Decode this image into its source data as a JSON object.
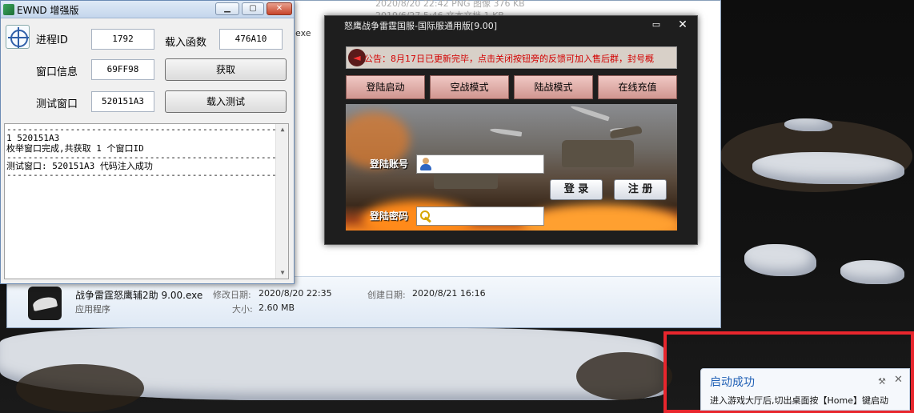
{
  "explorer": {
    "top_row_1": "2020/8/20 22:42     PNG 图像        376 KB",
    "top_row_2": "2019/6/27 5:46       文本文档          1 KB",
    "exe_label": "exe",
    "details": {
      "file_name": "战争雷霆怒鹰辅2助 9.00.exe",
      "file_type": "应用程序",
      "modified_label": "修改日期:",
      "modified_value": "2020/8/20 22:35",
      "created_label": "创建日期:",
      "created_value": "2020/8/21 16:16",
      "size_label": "大小:",
      "size_value": "2.60 MB"
    }
  },
  "ewnd": {
    "title": "EWND 增强版",
    "buttons": {
      "minimize": "▁",
      "maximize": "▢",
      "close": "✕"
    },
    "process_id_label": "进程ID",
    "process_id_value": "1792",
    "load_func_label": "载入函数",
    "load_func_value": "476A10",
    "window_info_label": "窗口信息",
    "window_info_value": "69FF98",
    "get_button": "获取",
    "test_window_label": "测试窗口",
    "test_window_value": "520151A3",
    "load_test_button": "载入测试",
    "log": {
      "separator": "------------------------------------------------------------",
      "line1": "1 520151A3",
      "line2": "枚举窗口完成,共获取 1 个窗口ID",
      "line3": "测试窗口: 520151A3 代码注入成功"
    }
  },
  "game": {
    "title": "怒鹰战争雷霆国服-国际服通用版[9.00]",
    "chat_icon": "💬",
    "close_icon": "✕",
    "notice": "公告：8月17日已更新完毕，点击关闭按钮旁的反馈可加入售后群，封号概",
    "modes": [
      "登陆启动",
      "空战模式",
      "陆战模式",
      "在线充值"
    ],
    "account_label": "登陆账号",
    "password_label": "登陆密码",
    "login_button": "登 录",
    "register_button": "注 册"
  },
  "toast": {
    "title": "启动成功",
    "message": "进入游戏大厅后,切出桌面按【Home】键启动",
    "pin_icon": "🔧",
    "close_icon": "✕"
  },
  "colors": {
    "highlight": "#e8262d",
    "notice_text": "#d40000",
    "toast_title": "#1f5fb5"
  }
}
